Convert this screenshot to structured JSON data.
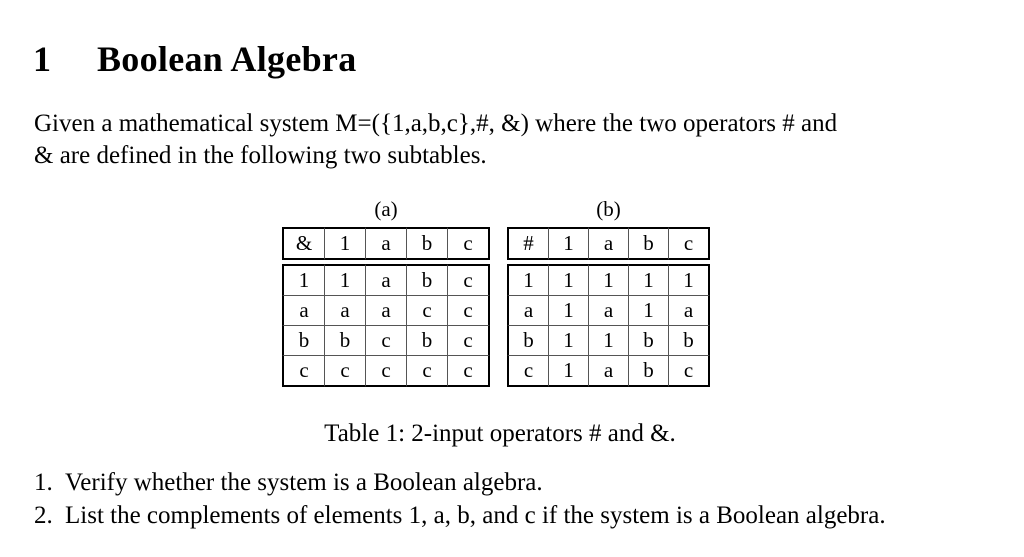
{
  "section": {
    "number": "1",
    "title": "Boolean Algebra"
  },
  "paragraph": {
    "line1": "Given a mathematical system M=({1,a,b,c},#, &) where the two operators # and",
    "line2": "& are defined in the following two subtables."
  },
  "subtables": {
    "a": {
      "label": "(a)",
      "operator": "&",
      "columns": [
        "1",
        "a",
        "b",
        "c"
      ],
      "rows": [
        {
          "row": "1",
          "cells": [
            "1",
            "a",
            "b",
            "c"
          ]
        },
        {
          "row": "a",
          "cells": [
            "a",
            "a",
            "c",
            "c"
          ]
        },
        {
          "row": "b",
          "cells": [
            "b",
            "c",
            "b",
            "c"
          ]
        },
        {
          "row": "c",
          "cells": [
            "c",
            "c",
            "c",
            "c"
          ]
        }
      ]
    },
    "b": {
      "label": "(b)",
      "operator": "#",
      "columns": [
        "1",
        "a",
        "b",
        "c"
      ],
      "rows": [
        {
          "row": "1",
          "cells": [
            "1",
            "1",
            "1",
            "1"
          ]
        },
        {
          "row": "a",
          "cells": [
            "1",
            "a",
            "1",
            "a"
          ]
        },
        {
          "row": "b",
          "cells": [
            "1",
            "1",
            "b",
            "b"
          ]
        },
        {
          "row": "c",
          "cells": [
            "1",
            "a",
            "b",
            "c"
          ]
        }
      ]
    }
  },
  "caption": "Table 1: 2-input operators # and &.",
  "questions": [
    {
      "number": "1.",
      "text": "Verify whether the system is a Boolean algebra."
    },
    {
      "number": "2.",
      "text": "List the complements of elements 1, a, b, and c if the system is a Boolean algebra."
    }
  ]
}
